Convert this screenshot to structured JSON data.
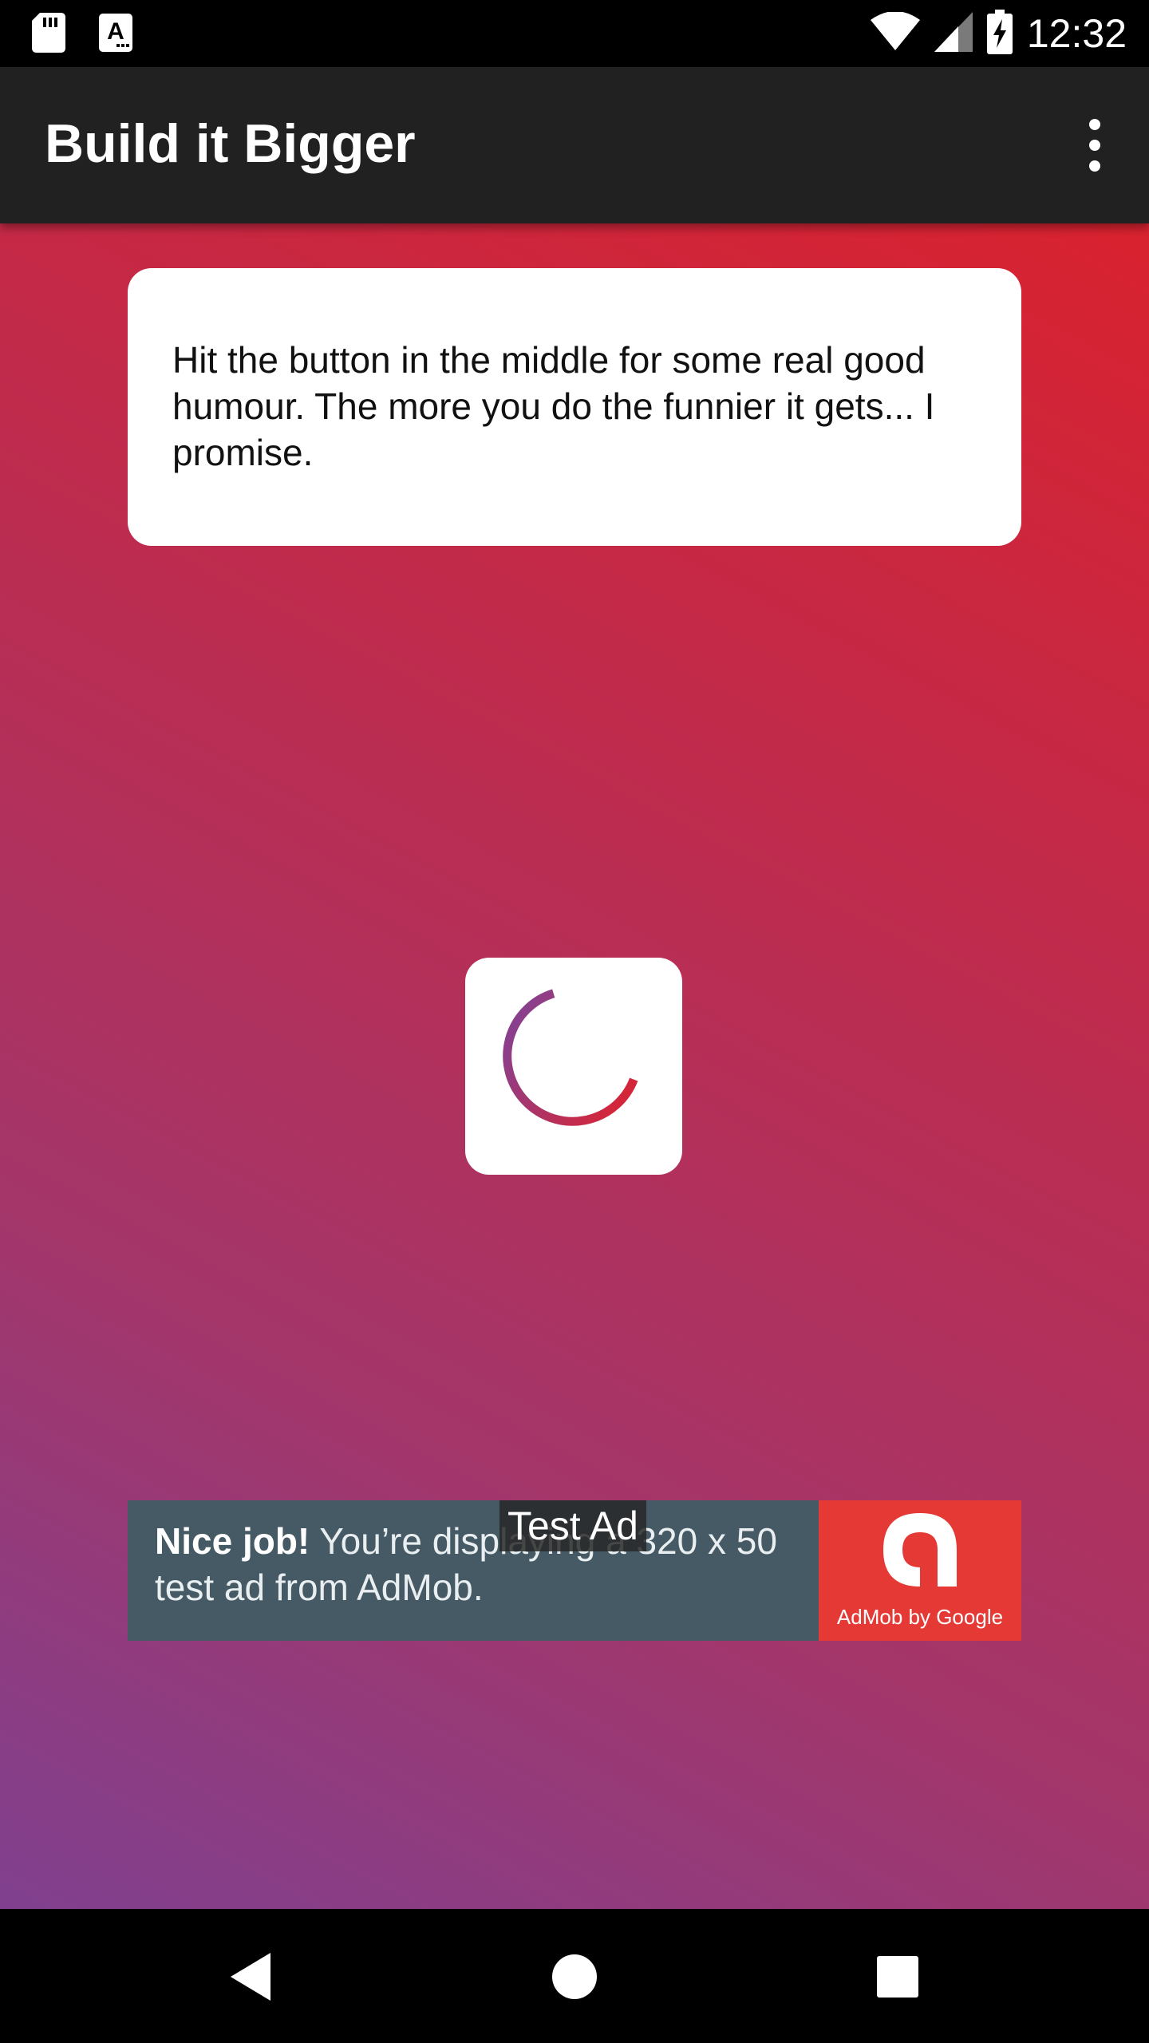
{
  "status_bar": {
    "time": "12:32",
    "icons": [
      "sd-card-icon",
      "text-a-icon",
      "wifi-icon",
      "signal-icon",
      "battery-charging-icon"
    ]
  },
  "app_bar": {
    "title": "Build it Bigger",
    "menu_icon": "more-vert-icon"
  },
  "card": {
    "text": "Hit the button in the middle for some real good humour. The more you do the funnier it gets... I promise."
  },
  "joke_button": {
    "state": "loading",
    "icon": "progress-spinner-icon"
  },
  "ad": {
    "bold_text": "Nice job!",
    "text": " You’re displaying a 320 x 50 test ad from AdMob.",
    "label": "Test Ad",
    "logo_caption": "AdMob by Google"
  },
  "nav_bar": {
    "buttons": [
      "back-icon",
      "home-icon",
      "recents-icon"
    ]
  },
  "colors": {
    "gradient_top_right": "#d9222f",
    "gradient_bottom_left": "#80408f",
    "app_bar": "#212121",
    "ad_background": "#455a64",
    "ad_logo_background": "#e53935"
  }
}
